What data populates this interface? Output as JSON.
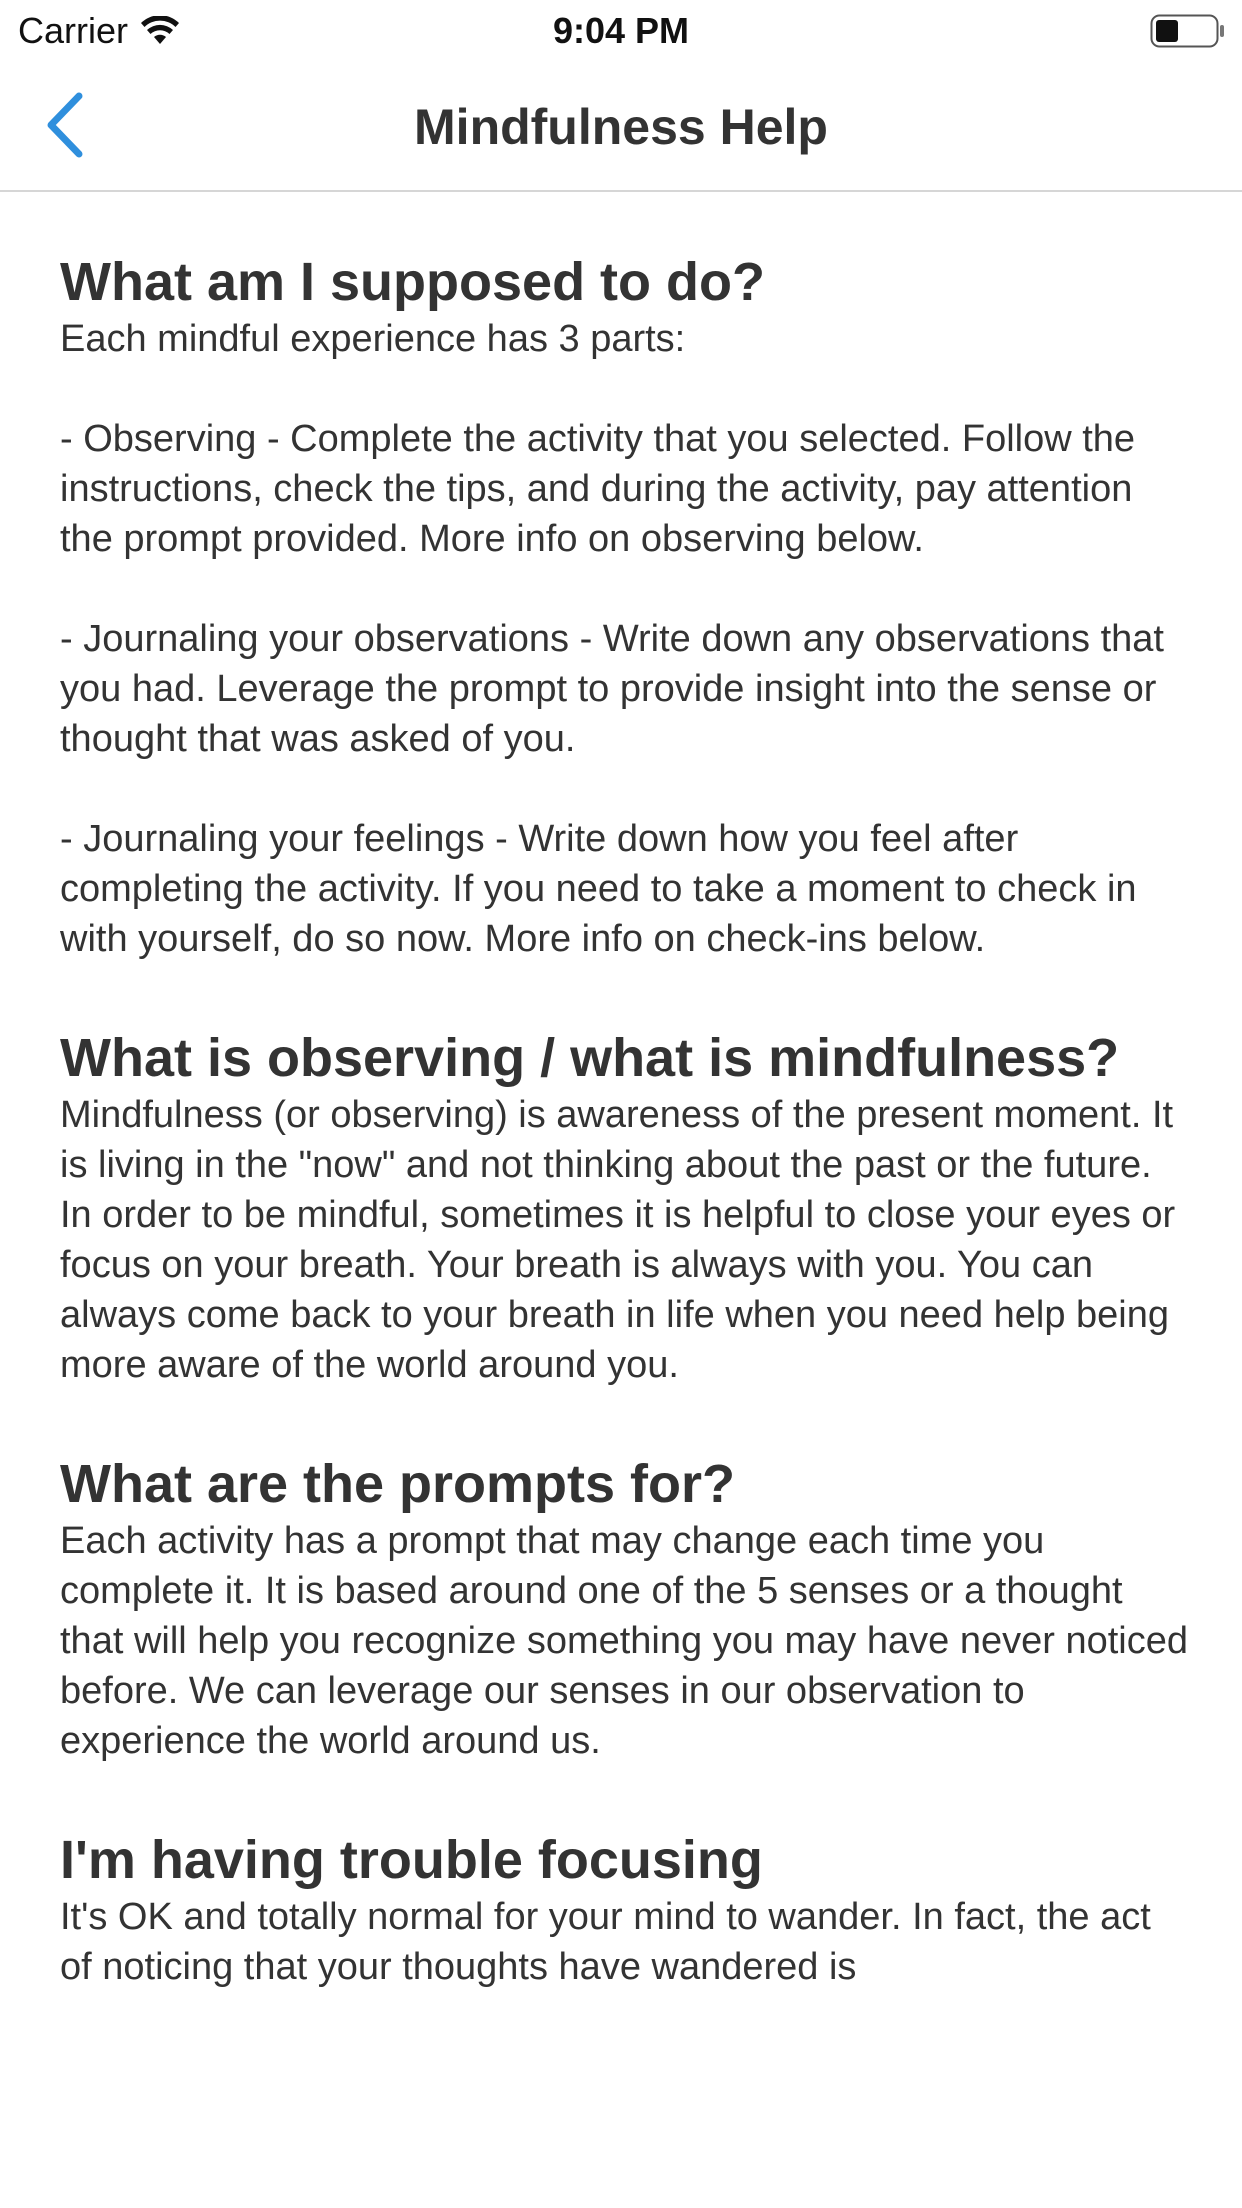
{
  "status_bar": {
    "carrier": "Carrier",
    "time": "9:04 PM",
    "wifi_icon": "wifi-icon",
    "battery_icon": "battery-icon"
  },
  "nav": {
    "title": "Mindfulness Help",
    "back_icon": "chevron-left-icon",
    "accent_color": "#2f8fdd"
  },
  "sections": [
    {
      "heading": "What am I supposed to do?",
      "paragraphs": [
        "Each mindful experience has 3 parts:",
        "- Observing - Complete the activity that you selected. Follow the instructions, check the tips, and during the activity, pay attention the prompt provided. More info on observing below.",
        "- Journaling your observations - Write down any observations that you had. Leverage the prompt to provide insight into the sense or thought that was asked of you.",
        "- Journaling your feelings - Write down how you feel after completing the activity. If you need to take a moment to check in with yourself, do so now. More info on check-ins below."
      ]
    },
    {
      "heading": "What is observing / what is mindfulness?",
      "paragraphs": [
        "Mindfulness (or observing) is awareness of the present moment. It is living in the \"now\" and not thinking about the past or the future. In order to be mindful, sometimes it is helpful to close your eyes or focus on your breath. Your breath is always with you. You can always come back to your breath in life when you need help being more aware of the world around you."
      ]
    },
    {
      "heading": "What are the prompts for?",
      "paragraphs": [
        "Each activity has a prompt that may change each time you complete it. It is based around one of the 5 senses or a thought that will help you recognize something you may have never noticed before. We can leverage our senses in our observation to experience the world around us."
      ]
    },
    {
      "heading": "I'm having trouble focusing",
      "paragraphs": [
        "It's OK and totally normal for your mind to wander. In fact, the act of noticing that your thoughts have wandered is"
      ]
    }
  ]
}
